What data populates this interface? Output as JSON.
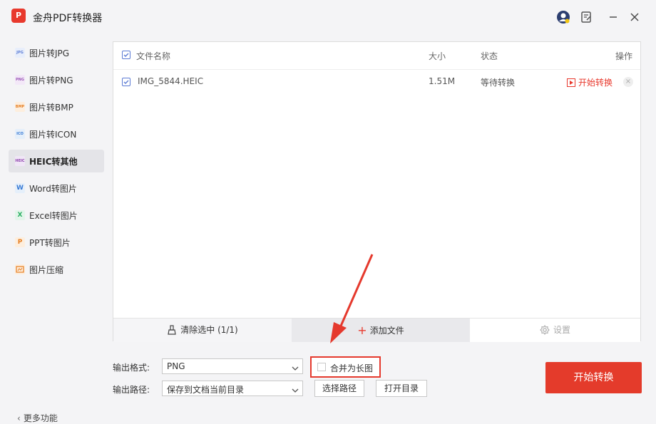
{
  "app": {
    "title": "金舟PDF转换器",
    "logo_text": "P"
  },
  "sidebar": {
    "items": [
      {
        "label": "图片转JPG",
        "icon": "jpg-icon",
        "icon_text": "JPG",
        "color": "#5b7bd4",
        "active": false
      },
      {
        "label": "图片转PNG",
        "icon": "png-icon",
        "icon_text": "PNG",
        "color": "#9b59b6",
        "active": false
      },
      {
        "label": "图片转BMP",
        "icon": "bmp-icon",
        "icon_text": "BMP",
        "color": "#e67e22",
        "active": false
      },
      {
        "label": "图片转ICON",
        "icon": "icon-file-icon",
        "icon_text": "ICO",
        "color": "#3a7bd5",
        "active": false
      },
      {
        "label": "HEIC转其他",
        "icon": "heic-icon",
        "icon_text": "HEIC",
        "color": "#8e44ad",
        "active": true
      },
      {
        "label": "Word转图片",
        "icon": "word-icon",
        "icon_text": "W",
        "color": "#3a7bd5",
        "active": false
      },
      {
        "label": "Excel转图片",
        "icon": "excel-icon",
        "icon_text": "X",
        "color": "#27ae60",
        "active": false
      },
      {
        "label": "PPT转图片",
        "icon": "ppt-icon",
        "icon_text": "P",
        "color": "#e67e22",
        "active": false
      },
      {
        "label": "图片压缩",
        "icon": "compress-icon",
        "icon_text": "",
        "color": "#e67e22",
        "active": false
      }
    ],
    "more_label": "更多功能"
  },
  "table": {
    "headers": {
      "name": "文件名称",
      "size": "大小",
      "status": "状态",
      "action": "操作"
    },
    "rows": [
      {
        "name": "IMG_5844.HEIC",
        "size": "1.51M",
        "status": "等待转换",
        "action": "开始转换",
        "checked": true
      }
    ]
  },
  "toolbar": {
    "clear": "清除选中 (1/1)",
    "add": "添加文件",
    "settings": "设置"
  },
  "output": {
    "format_label": "输出格式:",
    "format_value": "PNG",
    "path_label": "输出路径:",
    "path_value": "保存到文档当前目录",
    "merge_label": "合并为长图",
    "merge_checked": false,
    "choose_path": "选择路径",
    "open_dir": "打开目录"
  },
  "start_button": "开始转换",
  "colors": {
    "accent": "#e43b2b",
    "primary_blue": "#5b7bd4",
    "annotation_red": "#e5392d"
  }
}
